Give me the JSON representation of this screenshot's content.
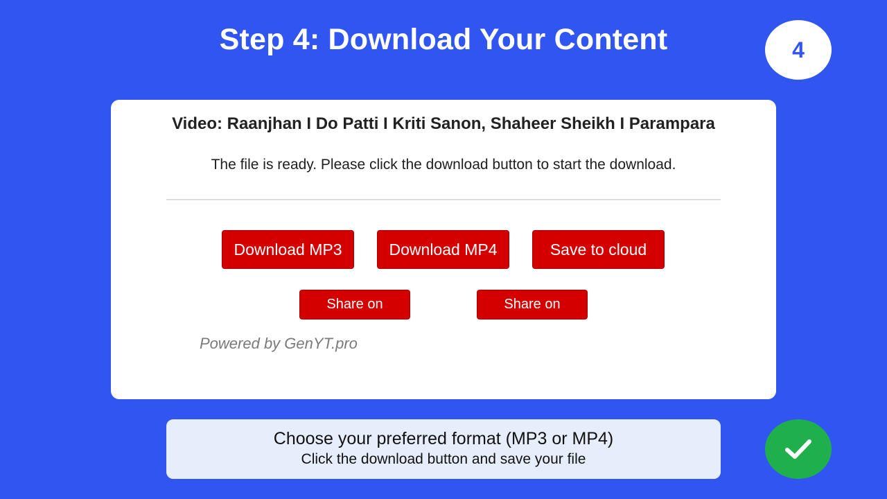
{
  "header": {
    "title": "Step 4: Download Your Content",
    "step_number": "4"
  },
  "card": {
    "video_title": "Video: Raanjhan I Do Patti I Kriti Sanon, Shaheer Sheikh I Parampara",
    "ready_text": "The file is ready. Please click the download button to start the download.",
    "buttons": {
      "download_mp3": "Download MP3",
      "download_mp4": "Download MP4",
      "save_cloud": "Save to cloud",
      "share_1": "Share on",
      "share_2": "Share on"
    },
    "powered_by": "Powered by GenYT.pro"
  },
  "hint": {
    "main": "Choose your preferred format (MP3 or MP4)",
    "sub": "Click the download button and save your file"
  },
  "icons": {
    "step_badge": "step-number-badge",
    "done": "check-icon"
  },
  "colors": {
    "background": "#3155f0",
    "button": "#d40000",
    "success": "#1faf4d",
    "hint_bg": "#e6eefc"
  }
}
